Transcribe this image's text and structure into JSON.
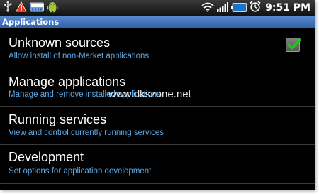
{
  "status_bar": {
    "time": "9:51 PM",
    "left_icons": [
      "usb-icon",
      "warning-icon",
      "sd-card-icon",
      "android-icon"
    ],
    "right_icons": [
      "wifi-icon",
      "signal-icon",
      "battery-icon",
      "alarm-icon"
    ]
  },
  "header": {
    "title": "Applications"
  },
  "items": [
    {
      "title": "Unknown sources",
      "subtitle": "Allow install of non-Market applications",
      "checked": true
    },
    {
      "title": "Manage applications",
      "subtitle": "Manage and remove installed applications"
    },
    {
      "title": "Running services",
      "subtitle": "View and control currently running services"
    },
    {
      "title": "Development",
      "subtitle": "Set options for application development"
    }
  ],
  "watermark": "www.dkszone.net",
  "colors": {
    "background": "#000000",
    "title_bar": "#3b6fbf",
    "subtitle": "#5fa8e3",
    "check": "#22c322"
  }
}
